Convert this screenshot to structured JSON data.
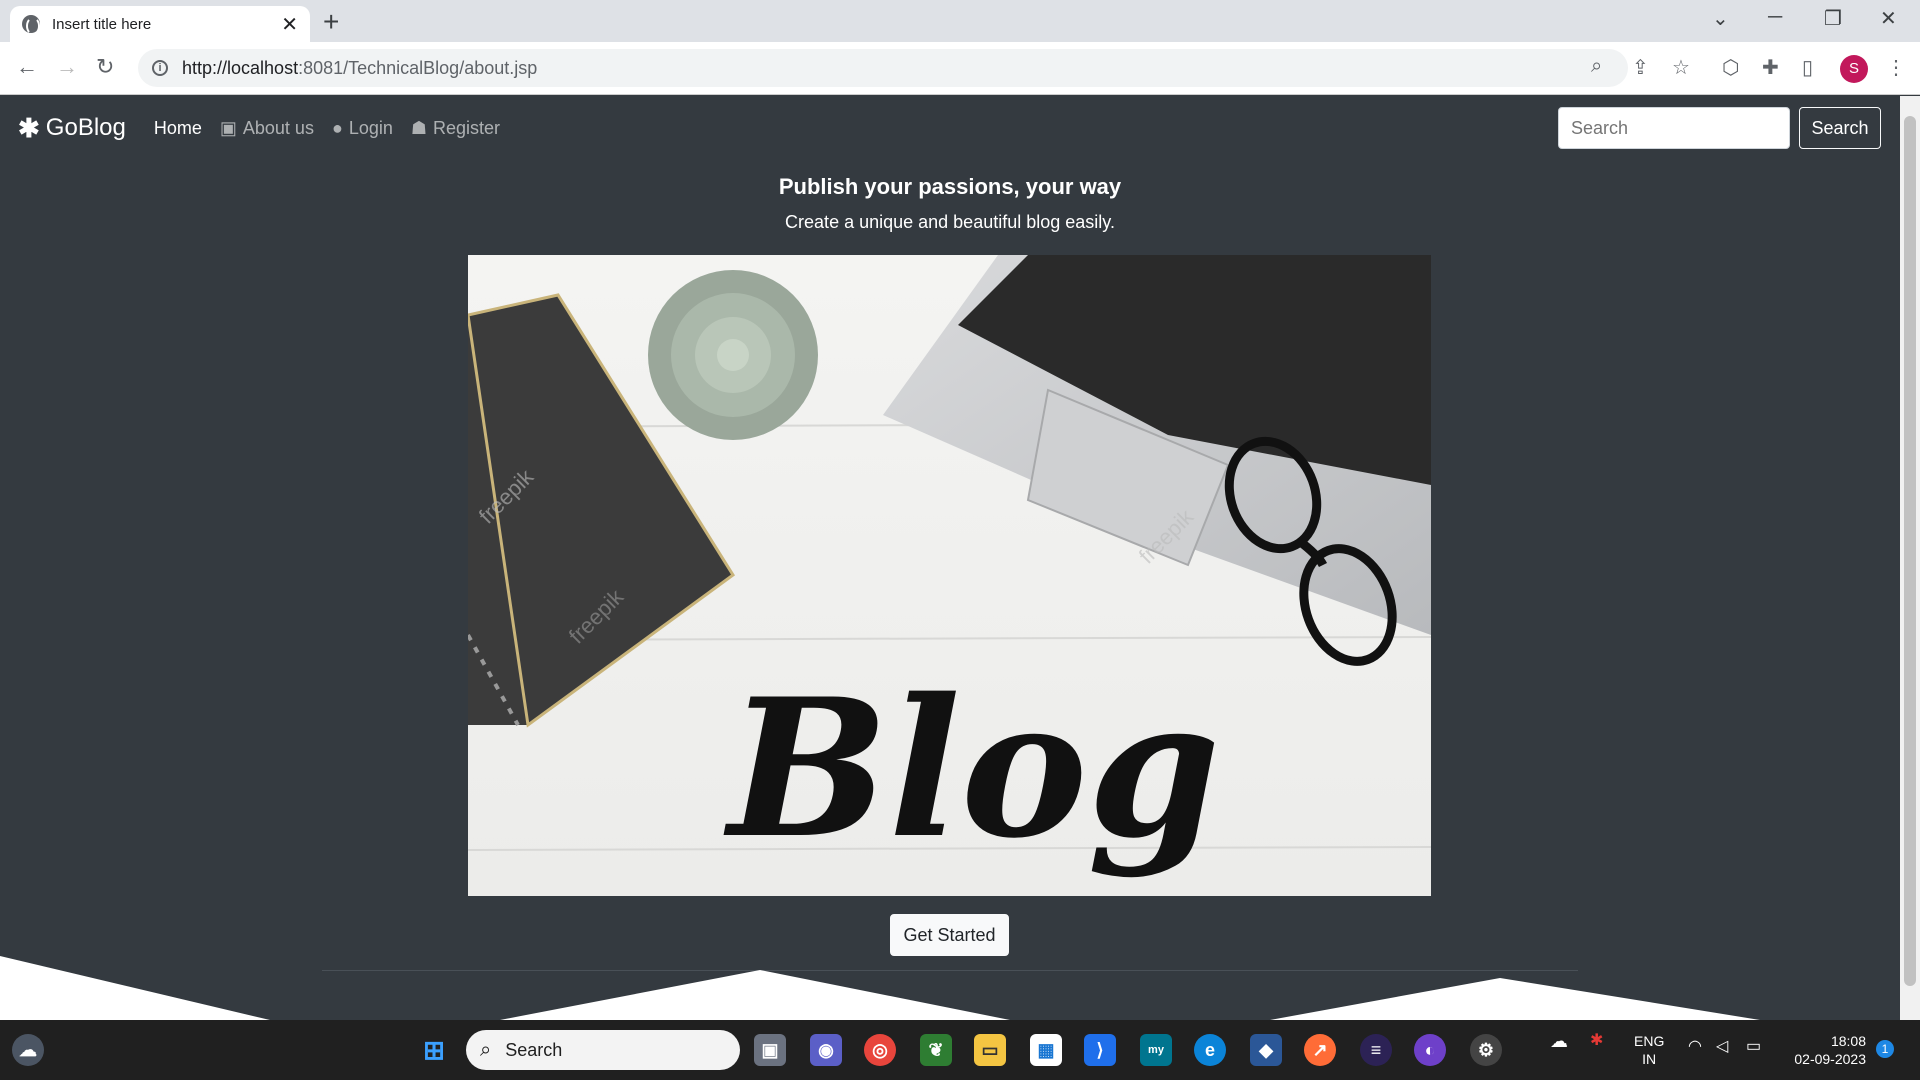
{
  "browser": {
    "tab_title": "Insert title here",
    "tab_close": "✕",
    "new_tab": "+",
    "url_host": "http://localhost",
    "url_rest": ":8081/TechnicalBlog/about.jsp",
    "profile_initial": "S"
  },
  "navbar": {
    "brand": "GoBlog",
    "links": [
      {
        "label": "Home",
        "icon": "home"
      },
      {
        "label": "About us",
        "icon": "id-card-icon"
      },
      {
        "label": "Login",
        "icon": "user-circle-icon"
      },
      {
        "label": "Register",
        "icon": "user-plus-icon"
      }
    ],
    "search_placeholder": "Search",
    "search_button": "Search"
  },
  "hero": {
    "title": "Publish your passions, your way",
    "subtitle": "Create a unique and beautiful blog easily.",
    "image_text": "Blog",
    "watermark": "freepik",
    "cta": "Get Started"
  },
  "taskbar": {
    "search_placeholder": "Search",
    "lang_top": "ENG",
    "lang_bottom": "IN",
    "time": "18:08",
    "date": "02-09-2023",
    "notification_count": "1"
  },
  "colors": {
    "page_bg": "#343a40",
    "avatar": "#c2185b"
  }
}
